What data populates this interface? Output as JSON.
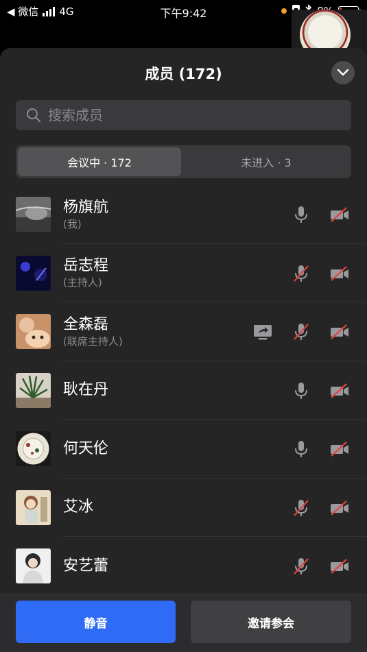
{
  "status_bar": {
    "back_label": "◀ 微信",
    "network": "4G",
    "time": "下午9:42",
    "battery": "8%"
  },
  "sheet": {
    "title": "成员 (172)",
    "search_placeholder": "搜索成员",
    "tabs": [
      {
        "label": "会议中 · 172",
        "active": true
      },
      {
        "label": "未进入 · 3",
        "active": false
      }
    ],
    "members": [
      {
        "name": "杨旗航",
        "role": "(我)",
        "mic": "on",
        "camera": "off"
      },
      {
        "name": "岳志程",
        "role": "(主持人)",
        "mic": "off",
        "camera": "off"
      },
      {
        "name": "全森磊",
        "role": "(联席主持人)",
        "sharing": true,
        "mic": "off",
        "camera": "off"
      },
      {
        "name": "耿在丹",
        "role": "",
        "mic": "on",
        "camera": "off"
      },
      {
        "name": "何天伦",
        "role": "",
        "mic": "on",
        "camera": "off"
      },
      {
        "name": "艾冰",
        "role": "",
        "mic": "off",
        "camera": "off"
      },
      {
        "name": "安艺蕾",
        "role": "",
        "mic": "off",
        "camera": "off"
      }
    ]
  },
  "footer": {
    "mute_label": "静音",
    "invite_label": "邀请参会"
  },
  "colors": {
    "sheet_bg": "#252526",
    "primary_button": "#2f6bf5",
    "secondary_button": "#404043",
    "muted_icon_slash": "#e0443e"
  }
}
